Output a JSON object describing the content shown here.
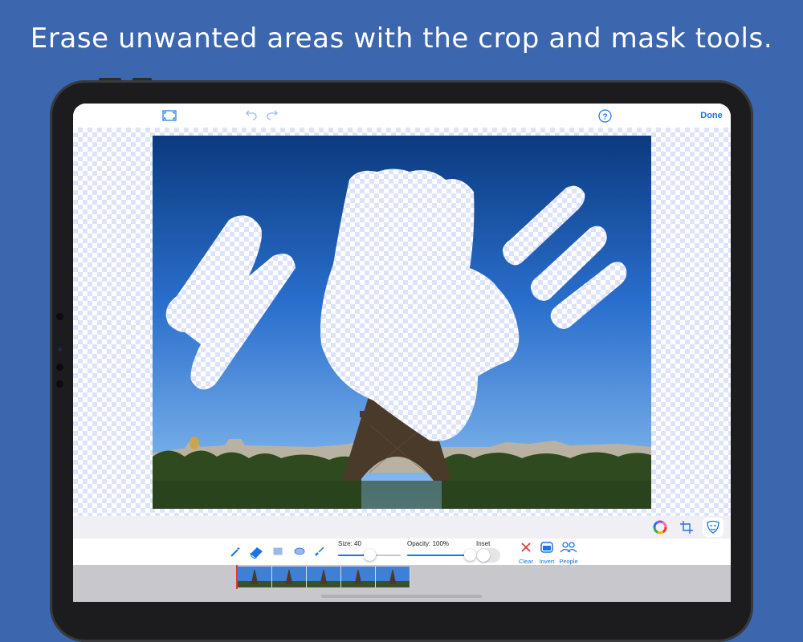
{
  "headline": "Erase unwanted areas with the crop and mask tools.",
  "topbar": {
    "done_label": "Done",
    "help_icon": "question-circle-icon",
    "fullscreen_icon": "expand-frame-icon",
    "undo_icon": "undo-icon",
    "redo_icon": "redo-icon"
  },
  "right_tools": [
    {
      "name": "color-wheel",
      "icon": "color-wheel-icon"
    },
    {
      "name": "crop",
      "icon": "crop-icon"
    },
    {
      "name": "mask",
      "icon": "mask-face-icon",
      "selected": true
    }
  ],
  "mask_tools": [
    {
      "name": "magic-wand",
      "icon": "magic-wand-icon"
    },
    {
      "name": "eraser",
      "icon": "eraser-icon",
      "selected": true
    },
    {
      "name": "rectangle",
      "icon": "rectangle-icon"
    },
    {
      "name": "ellipse",
      "icon": "ellipse-icon"
    },
    {
      "name": "brush",
      "icon": "brush-icon"
    }
  ],
  "controls": {
    "size_label": "Size: 40",
    "size_value_fraction": 0.5,
    "opacity_label": "Opacity: 100%",
    "opacity_value_fraction": 1.0,
    "inset_label": "Inset",
    "inset_on": false
  },
  "actions": [
    {
      "name": "clear",
      "label": "Clear",
      "icon": "x-icon",
      "color": "#e53935"
    },
    {
      "name": "invert",
      "label": "Invert",
      "icon": "invert-icon",
      "color": "#1a73e8"
    },
    {
      "name": "people",
      "label": "People",
      "icon": "people-icon",
      "color": "#1a73e8"
    }
  ],
  "colors": {
    "background": "#3c66ad",
    "accent": "#1a73e8",
    "clear_red": "#e53935",
    "checker": "#dde3fb"
  },
  "filmstrip": {
    "frame_count": 5
  }
}
